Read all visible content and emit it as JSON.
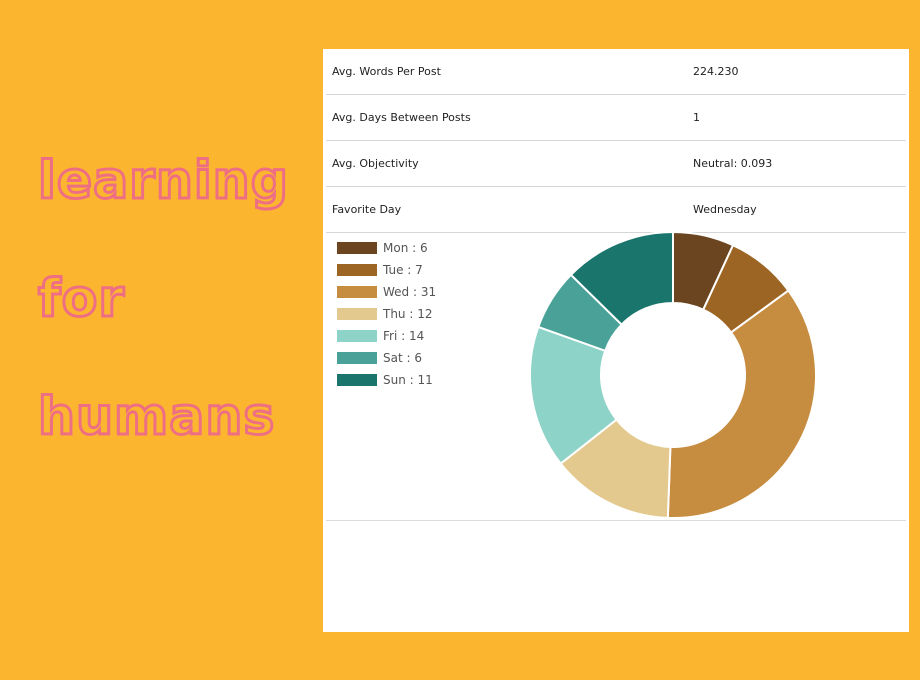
{
  "brand": {
    "line1": "learning",
    "line2": "for",
    "line3": "humans"
  },
  "stats": [
    {
      "label": "Avg. Words Per Post",
      "value": "224.230"
    },
    {
      "label": "Avg. Days Between Posts",
      "value": "1"
    },
    {
      "label": "Avg. Objectivity",
      "value": "Neutral: 0.093"
    },
    {
      "label": "Favorite Day",
      "value": "Wednesday"
    }
  ],
  "legend": [
    {
      "text": "Mon : 6",
      "color": "#6b4520"
    },
    {
      "text": "Tue : 7",
      "color": "#9c6523"
    },
    {
      "text": "Wed : 31",
      "color": "#c68c40"
    },
    {
      "text": "Thu : 12",
      "color": "#e3c98e"
    },
    {
      "text": "Fri : 14",
      "color": "#8ed3c8"
    },
    {
      "text": "Sat : 6",
      "color": "#4aa198"
    },
    {
      "text": "Sun : 11",
      "color": "#1a756d"
    }
  ],
  "chart_data": {
    "type": "pie",
    "donut": true,
    "categories": [
      "Mon",
      "Tue",
      "Wed",
      "Thu",
      "Fri",
      "Sat",
      "Sun"
    ],
    "values": [
      6,
      7,
      31,
      12,
      14,
      6,
      11
    ],
    "colors": [
      "#6b4520",
      "#9c6523",
      "#c68c40",
      "#e3c98e",
      "#8ed3c8",
      "#4aa198",
      "#1a756d"
    ],
    "legend": "top-left"
  }
}
